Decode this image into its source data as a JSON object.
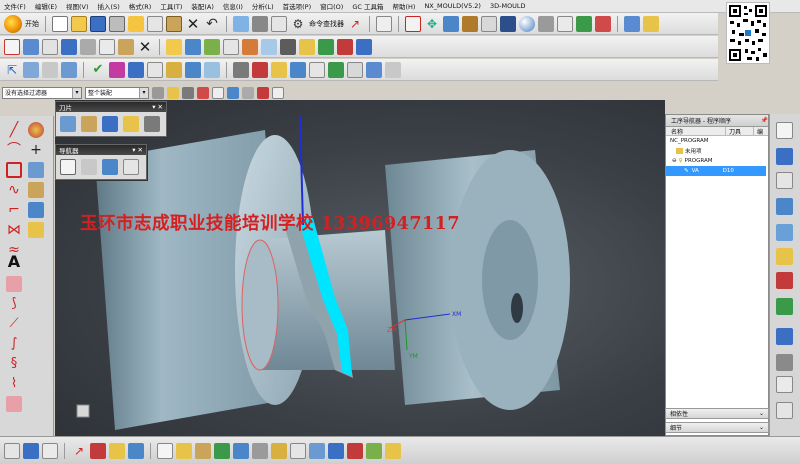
{
  "app": {
    "title": "NX_MOULD(V5.2)",
    "brand": "3D-MOULD"
  },
  "menu": [
    "文件(F)",
    "编辑(E)",
    "视图(V)",
    "插入(S)",
    "格式(R)",
    "工具(T)",
    "装配(A)",
    "信息(I)",
    "分析(L)",
    "首选项(P)",
    "窗口(O)",
    "GC 工具箱",
    "帮助(H)",
    "NX_MOULD(V5.2)",
    "3D-MOULD"
  ],
  "toolbar": {
    "start_label": "开始",
    "cmd_finder_label": "命令查找器"
  },
  "filters": {
    "selection_filter": "没有选择过滤器",
    "scope": "整个装配"
  },
  "floating": {
    "tool_title": "刀片",
    "nav_title": "导航器"
  },
  "watermark": "玉环市志成职业技能培训学校  13396947117",
  "navigator": {
    "title": "工序导航器 - 程序顺序",
    "col_name": "名称",
    "col_tool": "刀具",
    "col_extra": "编",
    "rows": [
      {
        "name": "NC_PROGRAM",
        "tool": ""
      },
      {
        "name": "未用项",
        "tool": ""
      },
      {
        "name": "PROGRAM",
        "tool": ""
      },
      {
        "name": "VA",
        "tool": "D10"
      }
    ],
    "dependencies": "相依性",
    "details": "细节"
  },
  "viewport": {
    "axis_labels": [
      "ZM",
      "XM",
      "YM"
    ]
  },
  "colors": {
    "highlight": "#00e5ff",
    "row_selected": "#3399ff",
    "watermark": "#d42020"
  }
}
